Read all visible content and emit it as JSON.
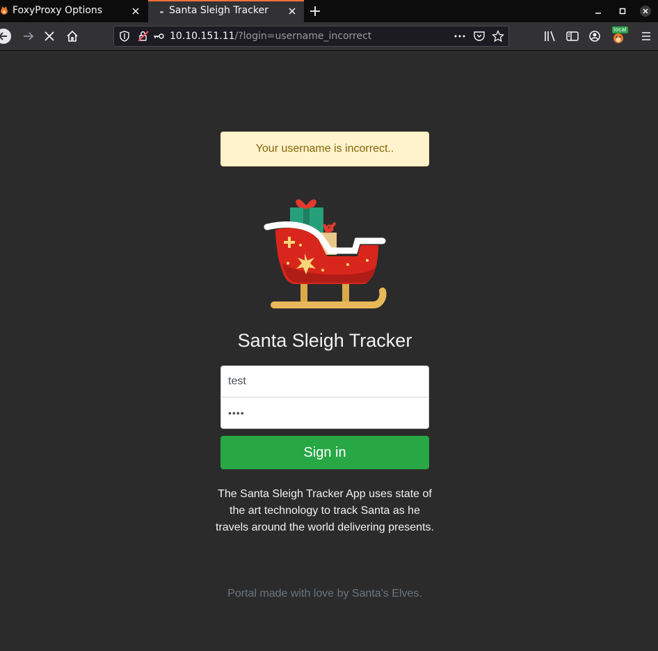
{
  "browser": {
    "tabs": [
      {
        "title": "FoxyProxy Options",
        "active": false
      },
      {
        "title": "Santa Sleigh Tracker",
        "active": true
      }
    ],
    "url": {
      "host": "10.10.151.11",
      "path": "/?login=username_incorrect"
    },
    "extension_badge": "local",
    "icons": {
      "back": "arrow-left-icon",
      "forward": "arrow-right-icon",
      "stop": "close-icon",
      "home": "home-icon",
      "shield": "shield-icon",
      "insecure": "insecure-lock-icon",
      "key": "key-icon",
      "more": "ellipsis-icon",
      "pocket": "pocket-icon",
      "bookmark": "star-icon",
      "library": "library-icon",
      "sidebar": "sidebar-icon",
      "account": "account-icon",
      "menu": "hamburger-icon"
    }
  },
  "page": {
    "alert": "Your username is incorrect..",
    "heading": "Santa Sleigh Tracker",
    "username_value": "test",
    "password_value": "••••",
    "signin_label": "Sign in",
    "description": "The Santa Sleigh Tracker App uses state of the art technology to track Santa as he travels around the world delivering presents.",
    "footer": "Portal made with love by Santa's Elves."
  },
  "colors": {
    "page_bg": "#2b2b2b",
    "alert_bg": "#fff3cd",
    "alert_text": "#856404",
    "signin_bg": "#28a745",
    "tab_accent": "#ff7139"
  }
}
